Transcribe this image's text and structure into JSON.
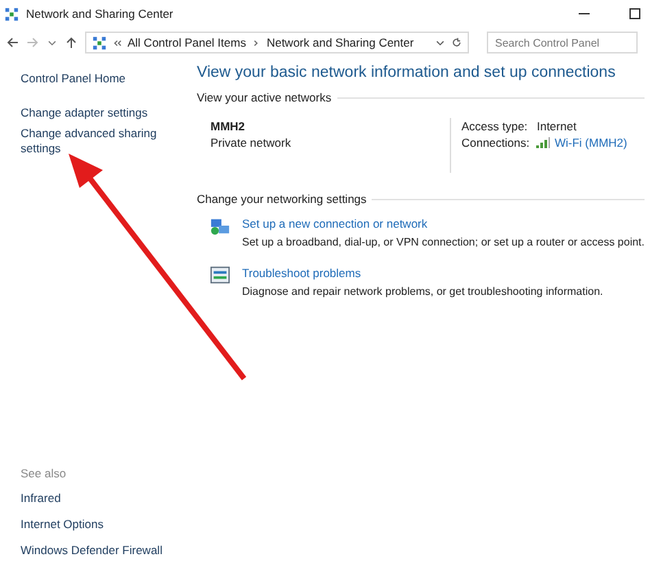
{
  "window": {
    "title": "Network and Sharing Center"
  },
  "address_bar": {
    "path": [
      "All Control Panel Items",
      "Network and Sharing Center"
    ],
    "search": {
      "placeholder": "Search Control Panel"
    }
  },
  "sidebar": {
    "items": [
      "Control Panel Home",
      "Change adapter settings",
      "Change advanced sharing settings"
    ],
    "see_also": {
      "heading": "See also",
      "items": [
        "Infrared",
        "Internet Options",
        "Windows Defender Firewall"
      ]
    }
  },
  "main": {
    "heading": "View your basic network information and set up connections",
    "active_networks": {
      "label": "View your active networks",
      "name": "MMH2",
      "type": "Private network",
      "access_type_label": "Access type:",
      "access_type": "Internet",
      "connections_label": "Connections:",
      "connection": "Wi-Fi (MMH2)"
    },
    "settings": {
      "label": "Change your networking settings",
      "tasks": [
        {
          "kind": "setup",
          "title": "Set up a new connection or network",
          "description": "Set up a broadband, dial-up, or VPN connection; or set up a router or access point."
        },
        {
          "kind": "troubleshoot",
          "title": "Troubleshoot problems",
          "description": "Diagnose and repair network problems, or get troubleshooting information."
        }
      ]
    }
  }
}
